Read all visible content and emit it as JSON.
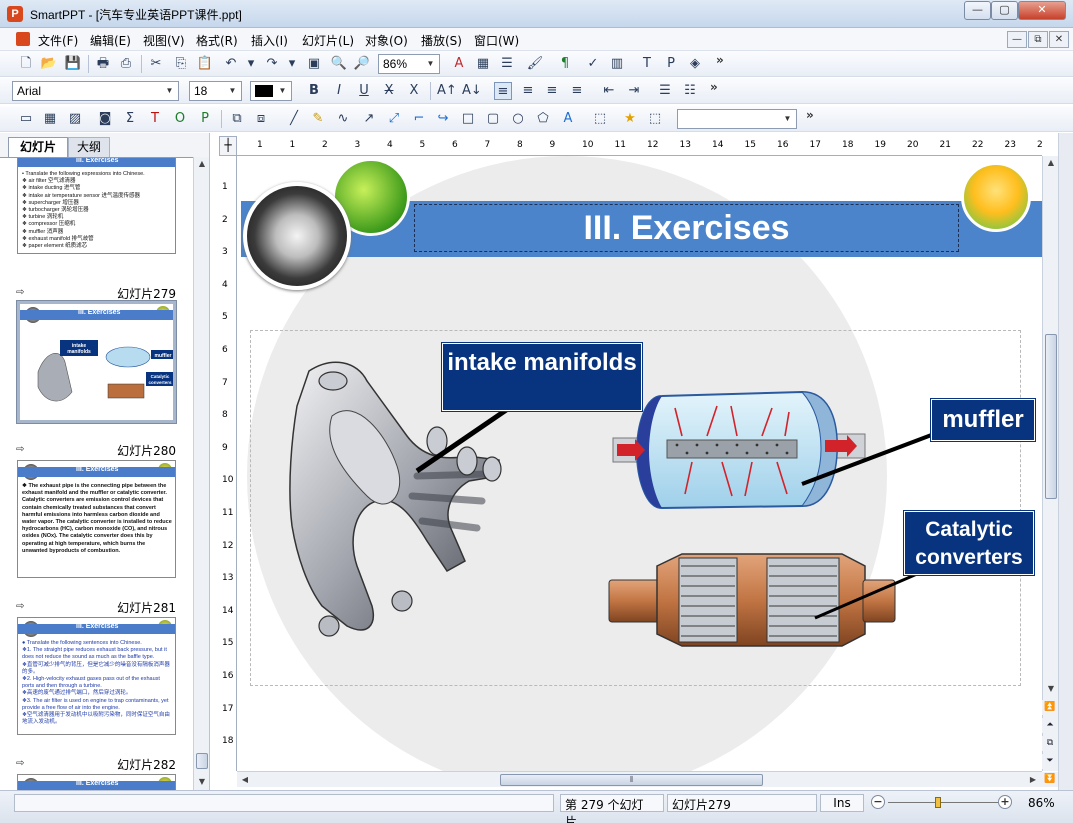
{
  "window": {
    "title": "SmartPPT - [汽车专业英语PPT课件.ppt]",
    "app_icon_letter": "P",
    "minimize": "—",
    "maximize": "▢",
    "close": "✕"
  },
  "menu": {
    "items": [
      "文件(F)",
      "编辑(E)",
      "视图(V)",
      "格式(R)",
      "插入(I)",
      "幻灯片(L)",
      "对象(O)",
      "播放(S)",
      "窗口(W)"
    ],
    "mdi": [
      "—",
      "⧉",
      "✕"
    ]
  },
  "toolbar1": {
    "zoom_value": "86%"
  },
  "toolbar2": {
    "font_name": "Arial",
    "font_size": "18"
  },
  "toolbar3": {
    "style_combo": ""
  },
  "left_panel": {
    "tabs": [
      "幻灯片",
      "大纲"
    ],
    "slides": [
      {
        "number": "",
        "title": "III. Exercises",
        "text": "• Translate the following expressions into Chinese.\n❖ air filter     空气滤清器\n❖ intake ducting     进气管\n❖ intake air temperature sensor     进气温度传感器\n❖ supercharger     增压器\n❖ turbocharger     涡轮增压器\n❖ turbine     涡轮机\n❖ compressor     压缩机\n❖ muffler     消声器\n❖ exhaust manifold     排气歧管\n❖ paper element     纸质滤芯"
      },
      {
        "number": "幻灯片279",
        "title": "III. Exercises",
        "text": ""
      },
      {
        "number": "幻灯片280",
        "title": "III. Exercises",
        "text": "❖ The exhaust pipe is the connecting pipe between the exhaust manifold and the muffler or catalytic converter. Catalytic converters are emission control devices that contain chemically treated substances that convert harmful emissions into harmless carbon dioxide and water vapor. The catalytic converter is installed to reduce hydrocarbons (HC), carbon monoxide (CO), and nitrous oxides (NOx). The catalytic converter does this by operating at high temperature, which burns the unwanted byproducts of combustion."
      },
      {
        "number": "幻灯片281",
        "title": "III. Exercises",
        "text": "● Translate the following sentences into Chinese.\n❖1.  The straight pipe reduces exhaust back pressure, but it does not reduce the sound as much as the baffle type.\n❖直管可减少排气的背压，但是它减少的噪音没有隔板消声器的多。\n❖2.  High-velocity exhaust gases pass out of the exhaust ports and then through a turbine.\n❖高速的废气通过排气端口，然后穿过涡轮。\n❖3.  The air filter is used on engine to trap contaminants, yet provide a free flow of air into the engine.\n❖空气滤清器用于发动机中以吸附污染物，同时保证空气自由地流入发动机。"
      },
      {
        "number": "幻灯片282",
        "title": "III. Exercises",
        "text": ""
      }
    ]
  },
  "ruler": {
    "h_numbers": [
      "1",
      "1",
      "2",
      "3",
      "4",
      "5",
      "6",
      "7",
      "8",
      "9",
      "10",
      "11",
      "12",
      "13",
      "14",
      "15",
      "16",
      "17",
      "18",
      "19",
      "20",
      "21",
      "22",
      "23",
      "24",
      "2"
    ],
    "v_numbers": [
      "1",
      "2",
      "3",
      "4",
      "5",
      "6",
      "7",
      "8",
      "9",
      "10",
      "11",
      "12",
      "13",
      "14",
      "15",
      "16",
      "17",
      "18"
    ]
  },
  "slide": {
    "title": "III. Exercises",
    "labels": {
      "intake": "intake manifolds",
      "muffler": "muffler",
      "catalytic": "Catalytic converters"
    },
    "colors": {
      "header_band": "#4b84cb",
      "label_bg": "#07337f",
      "label_text": "#ffffff"
    }
  },
  "status": {
    "empty_cell": "",
    "slide_count": "第 279 个幻灯片，",
    "current_slide": "幻灯片279",
    "mode": "Ins",
    "zoom": "86%",
    "zoom_level_fraction": 0.45
  },
  "icons": {
    "new": "new-document-icon",
    "open": "open-folder-icon",
    "save": "save-icon",
    "print": "print-icon",
    "pdf": "pdf-icon",
    "cut": "cut-icon",
    "copy": "copy-icon",
    "paste": "paste-icon",
    "undo": "undo-icon",
    "redo": "redo-icon"
  }
}
